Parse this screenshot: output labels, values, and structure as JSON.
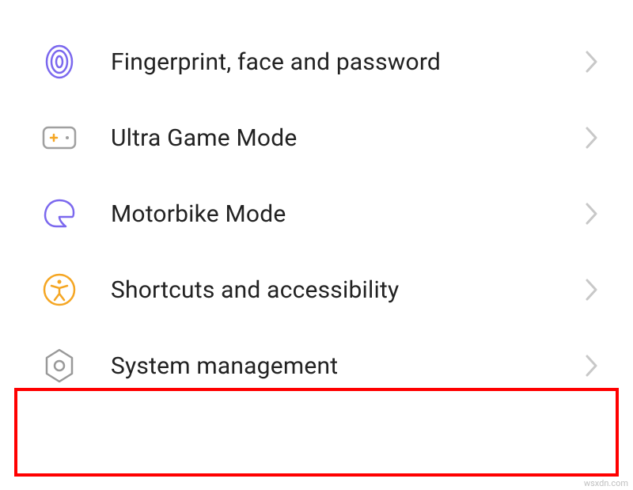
{
  "items": [
    {
      "key": "fingerprint",
      "label": "Fingerprint, face and password",
      "icon": "fingerprint-icon",
      "icon_color": "#7b68ee"
    },
    {
      "key": "ultra-game-mode",
      "label": "Ultra Game Mode",
      "icon": "gamepad-icon",
      "icon_color": "#a0a0a0"
    },
    {
      "key": "motorbike-mode",
      "label": "Motorbike Mode",
      "icon": "helmet-icon",
      "icon_color": "#7b68ee"
    },
    {
      "key": "shortcuts-accessibility",
      "label": "Shortcuts and accessibility",
      "icon": "accessibility-icon",
      "icon_color": "#f5a623"
    },
    {
      "key": "system-management",
      "label": "System management",
      "icon": "hex-gear-icon",
      "icon_color": "#999999"
    }
  ],
  "highlight_index": 4,
  "watermark": "wsxdn.com"
}
